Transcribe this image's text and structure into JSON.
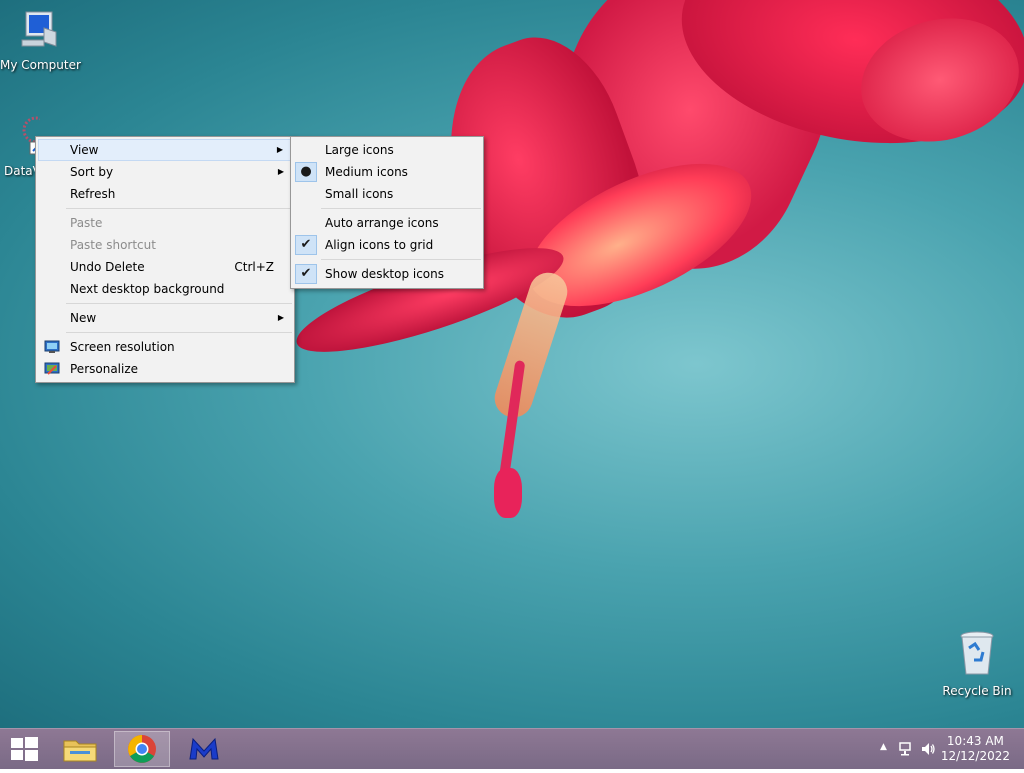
{
  "desktop": {
    "icons": [
      {
        "label": "My Computer",
        "icon": "computer-icon"
      },
      {
        "label": "DataV",
        "icon": "shortcut-icon"
      },
      {
        "label": "Recycle Bin",
        "icon": "recycle-bin-icon"
      }
    ]
  },
  "context_menu": {
    "items": [
      {
        "label": "View",
        "has_submenu": true,
        "highlighted": true
      },
      {
        "label": "Sort by",
        "has_submenu": true
      },
      {
        "label": "Refresh"
      },
      {
        "label": "Paste",
        "disabled": true
      },
      {
        "label": "Paste shortcut",
        "disabled": true
      },
      {
        "label": "Undo Delete",
        "shortcut": "Ctrl+Z"
      },
      {
        "label": "Next desktop background"
      },
      {
        "label": "New",
        "has_submenu": true
      },
      {
        "label": "Screen resolution",
        "icon": "screen-resolution-icon"
      },
      {
        "label": "Personalize",
        "icon": "personalize-icon"
      }
    ]
  },
  "view_submenu": {
    "items": [
      {
        "label": "Large icons"
      },
      {
        "label": "Medium icons",
        "selected": true
      },
      {
        "label": "Small icons"
      },
      {
        "label": "Auto arrange icons"
      },
      {
        "label": "Align icons to grid",
        "checked": true
      },
      {
        "label": "Show desktop icons",
        "checked": true
      }
    ]
  },
  "taskbar": {
    "pinned": [
      {
        "name": "file-explorer",
        "icon": "folder-icon"
      },
      {
        "name": "chrome",
        "icon": "chrome-icon",
        "active": true
      },
      {
        "name": "malwarebytes",
        "icon": "malwarebytes-icon"
      }
    ],
    "clock": {
      "time": "10:43 AM",
      "date": "12/12/2022"
    }
  },
  "colors": {
    "menu_bg": "#f2f2f2",
    "highlight": "#e3eefb",
    "taskbar": "#7a6a86"
  }
}
